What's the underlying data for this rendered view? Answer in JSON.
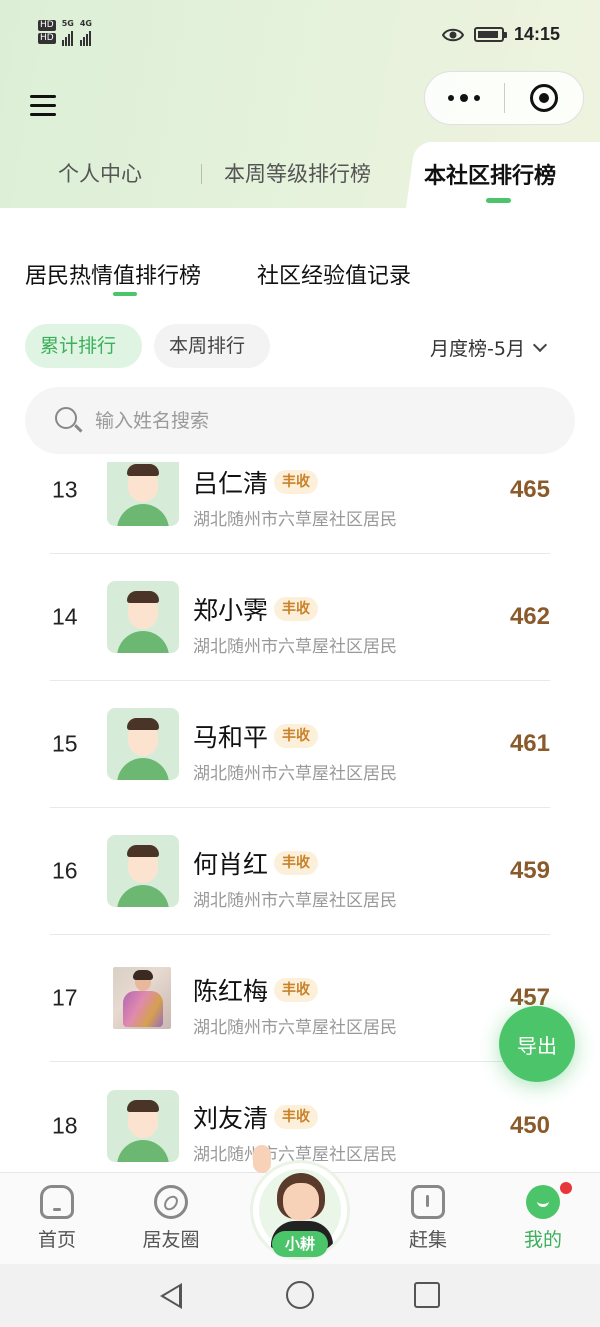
{
  "status_bar": {
    "time": "14:15",
    "hd1": "HD",
    "hd2": "HD",
    "net1": "5G",
    "net2": "4G"
  },
  "top_tabs": {
    "tab1": "个人中心",
    "tab2": "本周等级排行榜",
    "tab3": "本社区排行榜",
    "active": "本社区排行榜"
  },
  "sub_tabs": {
    "tab1": "居民热情值排行榜",
    "tab2": "社区经验值记录",
    "active": "居民热情值排行榜"
  },
  "filters": {
    "cumulative": "累计排行",
    "weekly": "本周排行",
    "month_selector": "月度榜-5月"
  },
  "search": {
    "placeholder": "输入姓名搜索"
  },
  "ranking": [
    {
      "rank": "13",
      "name": "吕仁清",
      "badge": "丰收",
      "address": "湖北随州市六草屋社区居民",
      "score": "465",
      "avatar": "default"
    },
    {
      "rank": "14",
      "name": "郑小霁",
      "badge": "丰收",
      "address": "湖北随州市六草屋社区居民",
      "score": "462",
      "avatar": "default"
    },
    {
      "rank": "15",
      "name": "马和平",
      "badge": "丰收",
      "address": "湖北随州市六草屋社区居民",
      "score": "461",
      "avatar": "default"
    },
    {
      "rank": "16",
      "name": "何肖红",
      "badge": "丰收",
      "address": "湖北随州市六草屋社区居民",
      "score": "459",
      "avatar": "default"
    },
    {
      "rank": "17",
      "name": "陈红梅",
      "badge": "丰收",
      "address": "湖北随州市六草屋社区居民",
      "score": "457",
      "avatar": "photo"
    },
    {
      "rank": "18",
      "name": "刘友清",
      "badge": "丰收",
      "address": "湖北随州市六草屋社区居民",
      "score": "450",
      "avatar": "default"
    }
  ],
  "export_button": "导出",
  "bottom_nav": {
    "home": "首页",
    "circle": "居友圈",
    "mascot": "小耕",
    "market": "赶集",
    "me": "我的",
    "active": "我的"
  },
  "colors": {
    "accent": "#4cc46a",
    "score": "#8a5a2b",
    "badge_text": "#c9822a",
    "badge_bg": "#fdf0da",
    "notification_dot": "#e8373a"
  }
}
